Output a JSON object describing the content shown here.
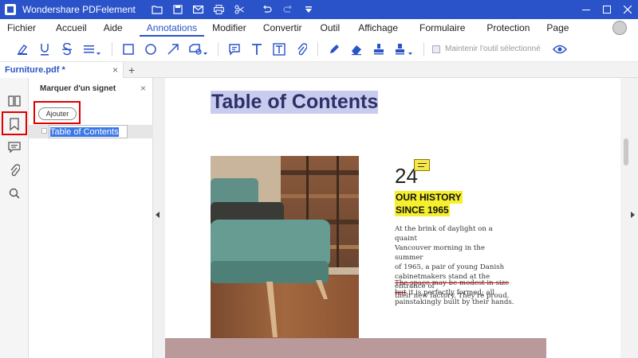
{
  "app": {
    "title": "Wondershare PDFelement"
  },
  "quick_access": [
    "folder-icon",
    "save-icon",
    "mail-icon",
    "print-icon",
    "scissors-icon",
    "undo-icon",
    "redo-icon",
    "dropdown-icon"
  ],
  "window_controls": [
    "minimize-icon",
    "maximize-icon",
    "close-icon"
  ],
  "menu": {
    "items": [
      "Fichier",
      "Accueil",
      "Aide",
      "Annotations",
      "Modifier",
      "Convertir",
      "Outil",
      "Affichage",
      "Formulaire",
      "Protection",
      "Page"
    ],
    "active": "Annotations"
  },
  "toolbar": {
    "tools": [
      "highlight-icon",
      "underline-icon",
      "strikethrough-icon",
      "lines-icon",
      "rectangle-icon",
      "ellipse-icon",
      "arrow-icon",
      "shape-icon",
      "comment-icon",
      "text-icon",
      "textbox-icon",
      "attachment-icon",
      "pencil-icon",
      "eraser-icon",
      "stamp-icon",
      "signature-icon",
      "eye-icon"
    ],
    "keep_tool_label": "Maintenir l'outil sélectionné"
  },
  "tabs": {
    "doc_name": "Furniture.pdf *",
    "close": "×",
    "add": "+"
  },
  "panel": {
    "title": "Marquer d'un signet",
    "close": "×",
    "add_button": "Ajouter",
    "bookmark_edit_value": "Table of Contents"
  },
  "document": {
    "heading": "Table of Contents",
    "number": "24",
    "history_line1": "OUR HISTORY",
    "history_line2": "SINCE 1965",
    "para1": "At the brink of daylight on a quaint\nVancouver morning in the summer\nof 1965, a pair of young Danish\ncabinetmakers stand at the entrance of\ntheir new factory. They're proud.",
    "para2_struck": "The space may be modest in size but",
    "para2_rest": " it is perfectly formed; all painstakingly built by their hands."
  },
  "colors": {
    "brand": "#2b53c9",
    "highlight_heading": "#c9cbef",
    "highlight_yellow": "#f5ef2e",
    "strike": "#d10000",
    "selection_box": "#e00000"
  }
}
